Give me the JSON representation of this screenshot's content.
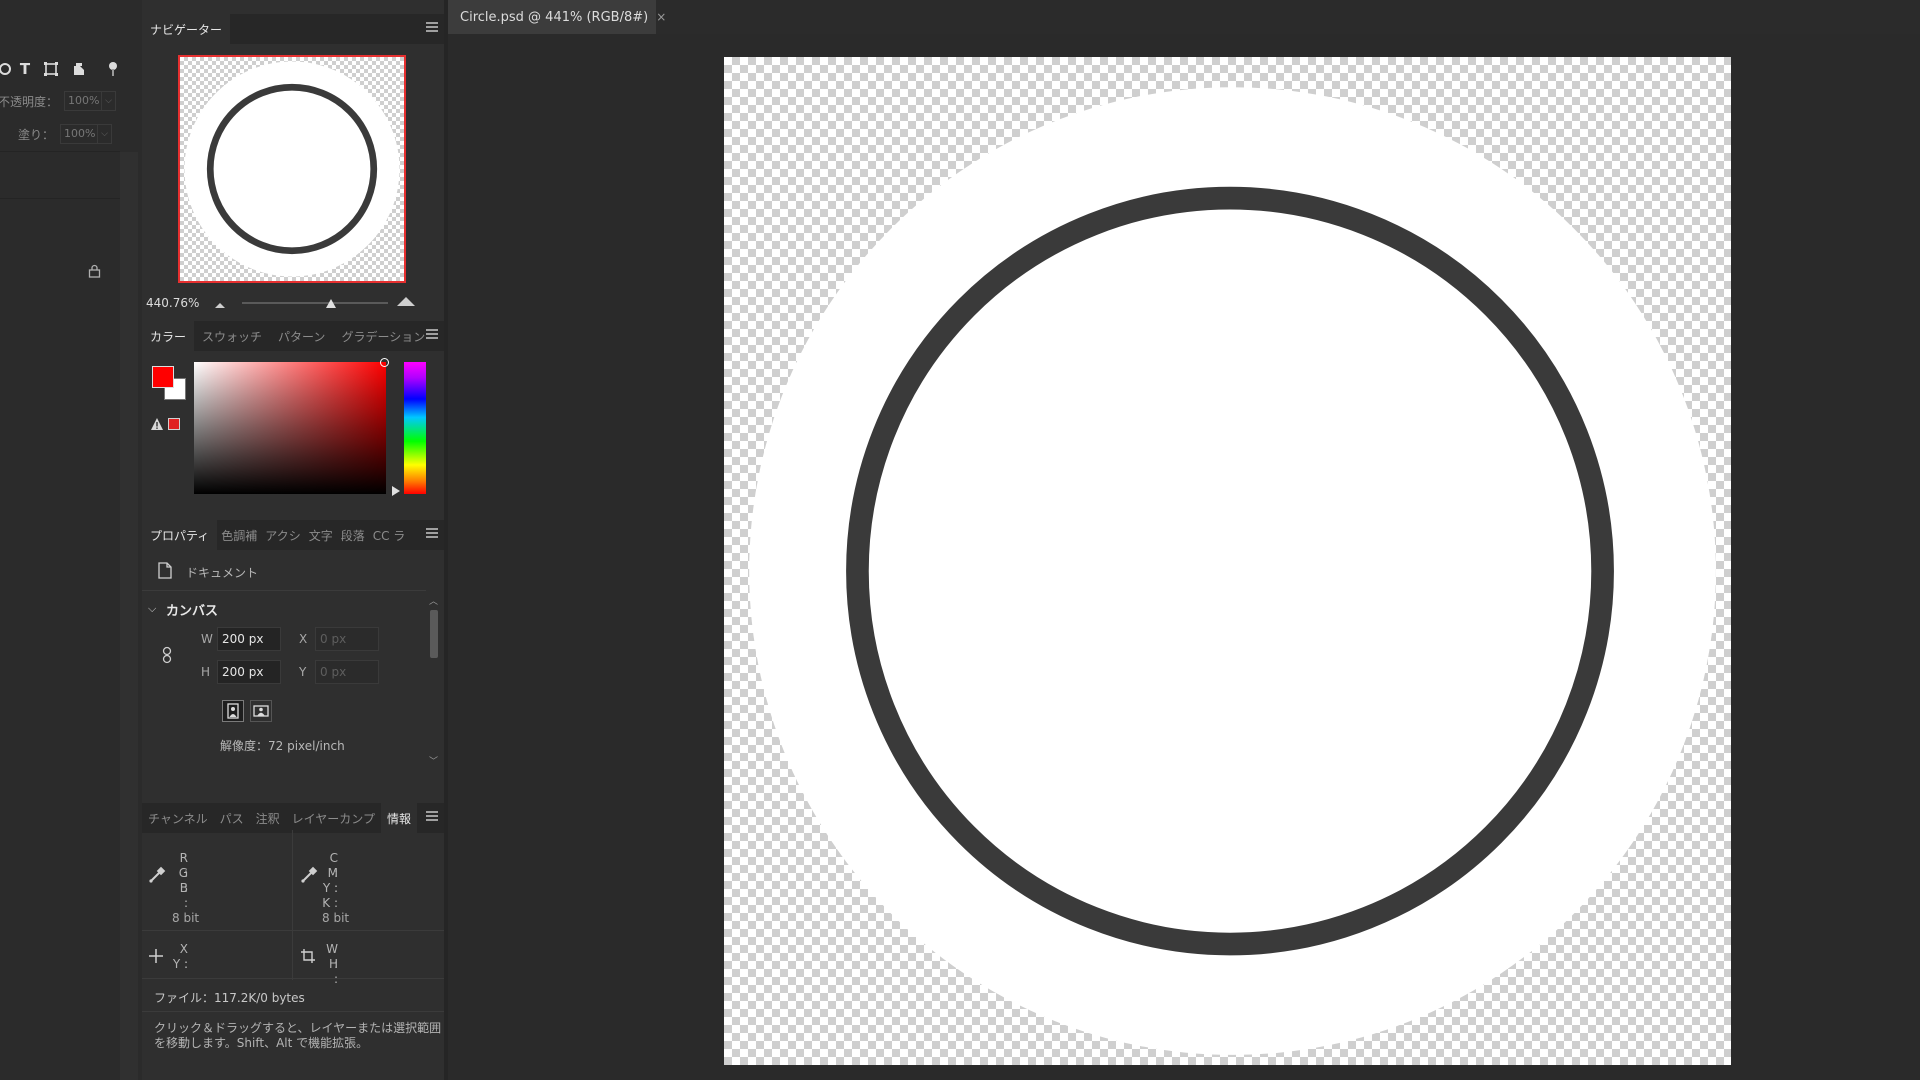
{
  "layers_strip": {
    "opacity_label": "不透明度：",
    "opacity_value": "100%",
    "fill_label": "塗り：",
    "fill_value": "100%"
  },
  "navigator": {
    "tab_label": "ナビゲーター",
    "zoom_value": "440.76%"
  },
  "color_panel": {
    "tabs": [
      "カラー",
      "スウォッチ",
      "パターン",
      "グラデーション"
    ],
    "foreground_color": "#ff0000",
    "background_color": "#ffffff"
  },
  "properties": {
    "tabs": [
      "プロパティ",
      "色調補",
      "アクシ",
      "文字",
      "段落",
      "CC ラ"
    ],
    "doc_type": "ドキュメント",
    "section_title": "カンバス",
    "w_label": "W",
    "w_value": "200 px",
    "h_label": "H",
    "h_value": "200 px",
    "x_label": "X",
    "x_value": "0 px",
    "y_label": "Y",
    "y_value": "0 px",
    "resolution": "解像度：72 pixel/inch"
  },
  "info_panel": {
    "tabs": [
      "チャンネル",
      "パス",
      "注釈",
      "レイヤーカンプ",
      "情報"
    ],
    "rgb_labels": [
      "R :",
      "G :",
      "B :"
    ],
    "cmyk_labels": [
      "C :",
      "M :",
      "Y :",
      "K :"
    ],
    "bit_left": "8 bit",
    "bit_right": "8 bit",
    "xy_labels": [
      "X :",
      "Y :"
    ],
    "wh_labels": [
      "W :",
      "H :"
    ],
    "file_info": "ファイル：117.2K/0 bytes",
    "hint_line1": "クリック＆ドラッグすると、レイヤーまたは選択範囲",
    "hint_line2": "を移動します。Shift、Alt で機能拡張。"
  },
  "document": {
    "tab_title": "Circle.psd @ 441% (RGB/8#)",
    "close_glyph": "×",
    "ring_color": "#3a3a3a",
    "fill_color": "#ffffff"
  }
}
